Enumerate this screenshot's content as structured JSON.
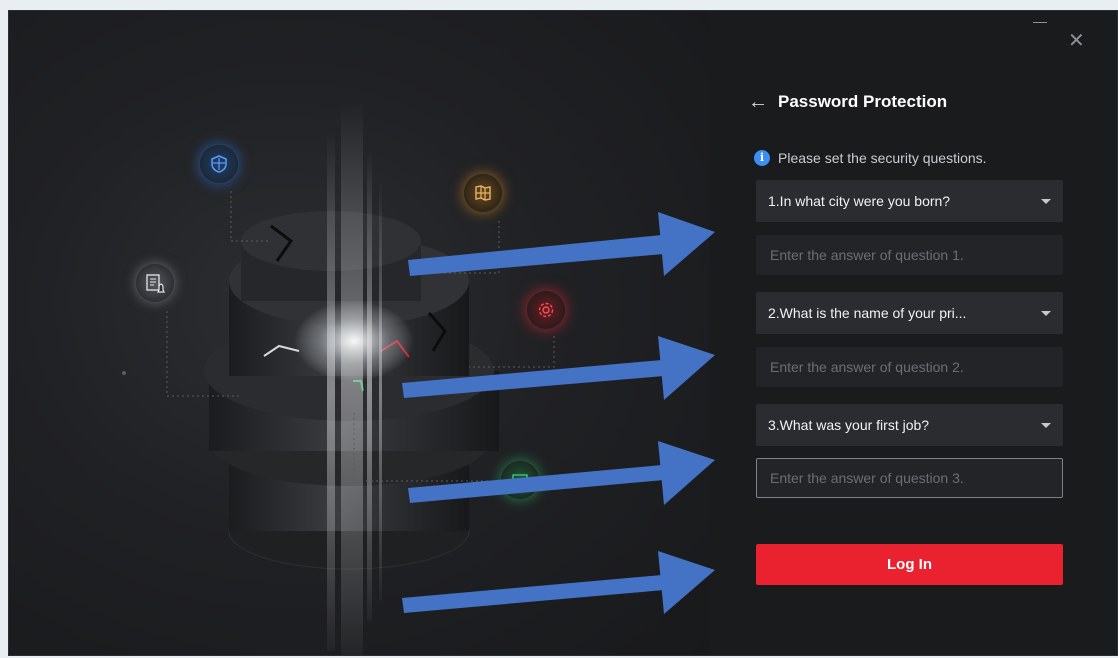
{
  "window": {
    "minimize_icon": "minimize-icon",
    "close_icon": "close-icon"
  },
  "panel": {
    "back_icon": "←",
    "title": "Password Protection",
    "info_text": "Please set the security questions.",
    "questions": [
      {
        "selected": "1.In what city were you born?",
        "answer_placeholder": "Enter the answer of question 1.",
        "answer_value": ""
      },
      {
        "selected": "2.What is the name of your pri...",
        "answer_placeholder": "Enter the answer of question 2.",
        "answer_value": ""
      },
      {
        "selected": "3.What was your first job?",
        "answer_placeholder": "Enter the answer of question 3.",
        "answer_value": ""
      }
    ],
    "login_label": "Log In"
  },
  "colors": {
    "accent": "#ea2230",
    "info": "#3a8ef6",
    "annotation_arrow": "#4472c4"
  }
}
